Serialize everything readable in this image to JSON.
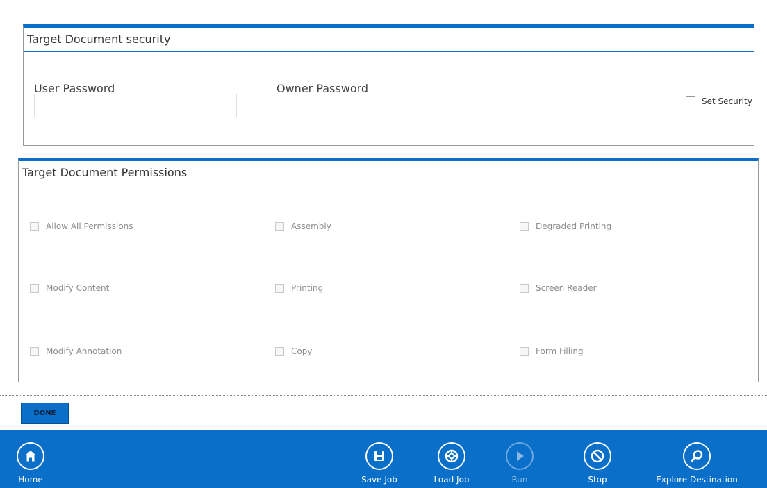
{
  "security": {
    "title": "Target Document security",
    "user_password_label": "User Password",
    "user_password_value": "",
    "owner_password_label": "Owner Password",
    "owner_password_value": "",
    "set_security_label": "Set Security",
    "set_security_checked": false
  },
  "permissions": {
    "title": "Target Document Permissions",
    "items": [
      {
        "label": "Allow All Permissions",
        "enabled": false
      },
      {
        "label": "Assembly",
        "enabled": false
      },
      {
        "label": "Degraded Printing",
        "enabled": false
      },
      {
        "label": "Modify Content",
        "enabled": false
      },
      {
        "label": "Printing",
        "enabled": false
      },
      {
        "label": "Screen Reader",
        "enabled": false
      },
      {
        "label": "Modify Annotation",
        "enabled": false
      },
      {
        "label": "Copy",
        "enabled": false
      },
      {
        "label": "Form Filling",
        "enabled": false
      }
    ]
  },
  "actions": {
    "done_label": "DONE"
  },
  "footer": {
    "home_label": "Home",
    "save_label": "Save Job",
    "load_label": "Load Job",
    "run_label": "Run",
    "stop_label": "Stop",
    "explore_label": "Explore Destination"
  },
  "colors": {
    "accent": "#0a6fc9",
    "disabled_text": "#8d8d8d",
    "footer_disabled": "#8cb8e6"
  },
  "icons": [
    "home-icon",
    "save-icon",
    "load-icon",
    "run-icon",
    "stop-icon",
    "search-icon"
  ]
}
